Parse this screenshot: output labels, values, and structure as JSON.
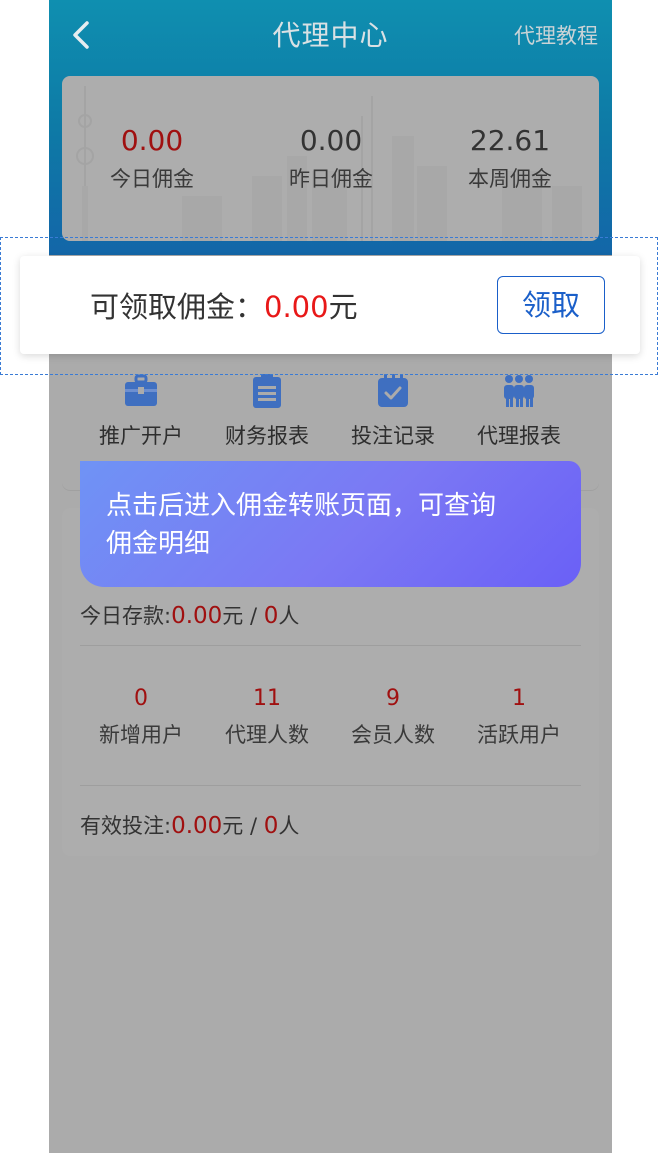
{
  "header": {
    "title": "代理中心",
    "back_icon": "chevron-left-icon",
    "tutorial_link": "代理教程"
  },
  "stats": [
    {
      "value": "0.00",
      "label": "今日佣金"
    },
    {
      "value": "0.00",
      "label": "昨日佣金"
    },
    {
      "value": "22.61",
      "label": "本周佣金"
    }
  ],
  "claim": {
    "label": "可领取佣金：",
    "amount": "0.00",
    "unit": "元",
    "button": "领取"
  },
  "menu": [
    {
      "icon": "briefcase-icon",
      "label": "推广开户"
    },
    {
      "icon": "document-list-icon",
      "label": "财务报表"
    },
    {
      "icon": "calendar-check-icon",
      "label": "投注记录"
    },
    {
      "icon": "people-group-icon",
      "label": "代理报表"
    }
  ],
  "tooltip": {
    "text_line1": "点击后进入佣金转账页面，可查询",
    "text_line2": "佣金明细"
  },
  "deposit": {
    "label": "今日存款:",
    "amount": "0.00",
    "unit": "元 / ",
    "count": "0",
    "count_unit": "人"
  },
  "counts": [
    {
      "value": "0",
      "label": "新增用户"
    },
    {
      "value": "11",
      "label": "代理人数"
    },
    {
      "value": "9",
      "label": "会员人数"
    },
    {
      "value": "1",
      "label": "活跃用户"
    }
  ],
  "valid_bets": {
    "label": "有效投注:",
    "amount": "0.00",
    "unit": "元 / ",
    "count": "0",
    "count_unit": "人"
  },
  "colors": {
    "header": "#0e7aa6",
    "accent_red": "#e81818",
    "link_blue": "#1a5fc9",
    "tooltip": "#7b78f4"
  }
}
